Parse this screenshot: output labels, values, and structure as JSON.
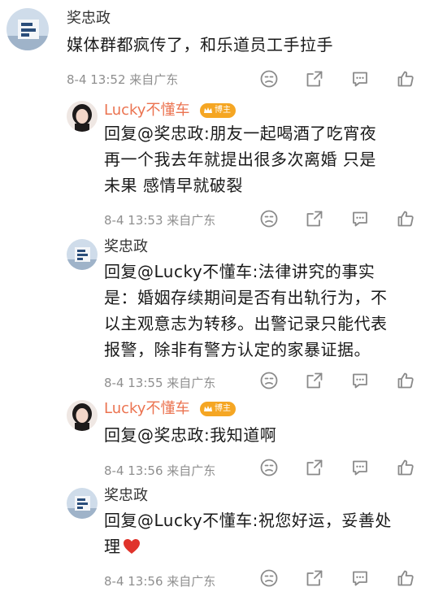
{
  "comments": [
    {
      "name": "奖忠政",
      "text": "媒体群都疯传了，和乐道员工手拉手",
      "meta": "8-4 13:52 来自广东"
    },
    {
      "name": "Lucky不懂车",
      "badge": "博主",
      "reply_prefix": "回复",
      "reply_to": "@奖忠政",
      "line1": ":朋友一起喝酒了吃宵夜",
      "line2": "再一个我去年就提出很多次离婚 只是",
      "line3": "未果 感情早就破裂",
      "meta": "8-4 13:53 来自广东"
    },
    {
      "name": "奖忠政",
      "reply_prefix": "回复",
      "reply_to": "@Lucky不懂车",
      "line1": ":法律讲究的事实",
      "line2": "是：婚姻存续期间是否有出轨行为，不",
      "line3": "以主观意志为转移。出警记录只能代表",
      "line4": "报警，除非有警方认定的家暴证据。",
      "meta": "8-4 13:55 来自广东"
    },
    {
      "name": "Lucky不懂车",
      "badge": "博主",
      "reply_prefix": "回复",
      "reply_to": "@奖忠政",
      "line1": ":我知道啊",
      "meta": "8-4 13:56 来自广东"
    },
    {
      "name": "奖忠政",
      "reply_prefix": "回复",
      "reply_to": "@Lucky不懂车",
      "line1": ":祝您好运，妥善处",
      "line2": "理",
      "meta": "8-4 13:56 来自广东"
    }
  ],
  "icons": {
    "actions": [
      "dislike-icon",
      "share-icon",
      "comment-icon",
      "like-icon"
    ],
    "emoji": "red-heart-icon"
  },
  "colors": {
    "vip_name": "#eb7350",
    "badge": "#f5a623",
    "meta_text": "#8f8f8f",
    "icon_stroke": "#8a8a8a",
    "heart": "#e0332b"
  }
}
